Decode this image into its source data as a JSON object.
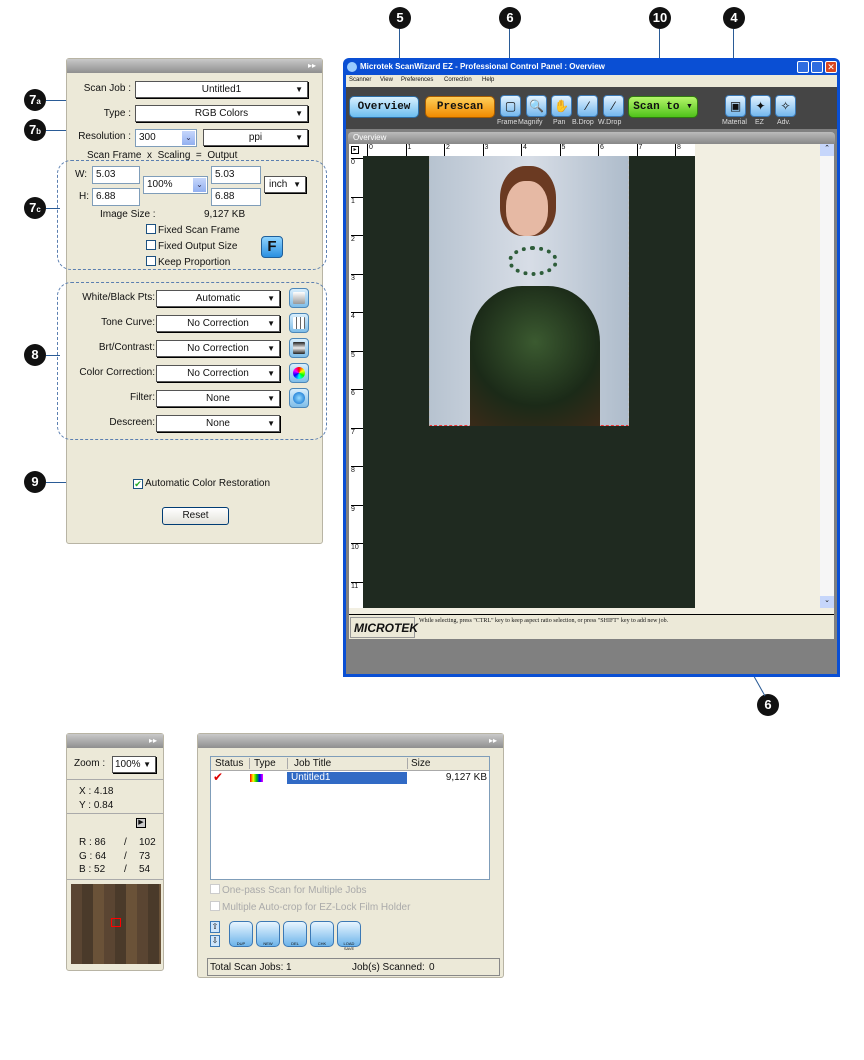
{
  "callouts": {
    "c5": "5",
    "c6a": "6",
    "c10": "10",
    "c4": "4",
    "c7a": "7",
    "c7a_sub": "a",
    "c7b": "7",
    "c7b_sub": "b",
    "c7c": "7",
    "c7c_sub": "c",
    "c8": "8",
    "c9": "9",
    "c6b": "6"
  },
  "settings": {
    "expand": "▸▸",
    "scan_job_label": "Scan Job :",
    "scan_job": "Untitled1",
    "type_label": "Type :",
    "type": "RGB Colors",
    "resolution_label": "Resolution :",
    "resolution": "300",
    "resolution_unit": "ppi",
    "header_row": "Scan Frame  x  Scaling  =  Output",
    "w_label": "W:",
    "h_label": "H:",
    "w_in": "5.03",
    "h_in": "6.88",
    "scaling": "100%",
    "w_out": "5.03",
    "h_out": "6.88",
    "unit": "inch",
    "image_size_label": "Image Size :",
    "image_size": "9,127 KB",
    "fixed_scan_frame": "Fixed Scan Frame",
    "fixed_output_size": "Fixed Output Size",
    "keep_proportion": "Keep Proportion",
    "f_button": "F",
    "corrections": [
      {
        "label": "White/Black Pts:",
        "value": "Automatic"
      },
      {
        "label": "Tone Curve:",
        "value": "No Correction"
      },
      {
        "label": "Brt/Contrast:",
        "value": "No Correction"
      },
      {
        "label": "Color Correction:",
        "value": "No Correction"
      },
      {
        "label": "Filter:",
        "value": "None"
      },
      {
        "label": "Descreen:",
        "value": "None"
      }
    ],
    "acr": "Automatic Color Restoration",
    "acr_checked": true,
    "reset": "Reset"
  },
  "window": {
    "title": "Microtek ScanWizard EZ - Professional Control Panel : Overview",
    "menu": [
      "Scanner",
      "View",
      "Preferences",
      "Correction",
      "Help"
    ],
    "overview": "Overview",
    "prescan": "Prescan",
    "scan_to": "Scan to ▾",
    "tools": [
      "Frame",
      "Magnify",
      "Pan",
      "B.Drop",
      "W.Drop"
    ],
    "modes": [
      "Material",
      "EZ",
      "Adv."
    ],
    "pane_title": "Overview",
    "ruler_x": [
      "0",
      "1",
      "2",
      "3",
      "4",
      "5",
      "6",
      "7",
      "8"
    ],
    "ruler_y": [
      "0",
      "1",
      "2",
      "3",
      "4",
      "5",
      "6",
      "7",
      "8",
      "9",
      "10",
      "11"
    ],
    "logo": "MICROTEK",
    "status": "While selecting, press \"CTRL\" key to keep aspect ratio selection, or press \"SHIFT\" key to add new job."
  },
  "info": {
    "expand": "▸▸",
    "zoom_label": "Zoom :",
    "zoom": "100%",
    "x": "X : 4.18",
    "y": "Y : 0.84",
    "r": "R : 86",
    "r2": "102",
    "g": "G : 64",
    "g2": "73",
    "b": "B : 52",
    "b2": "54",
    "sep": "/"
  },
  "jobs": {
    "expand": "▸▸",
    "columns": [
      "Status",
      "Type",
      "Job Title",
      "Size"
    ],
    "rows": [
      {
        "title": "Untitled1",
        "size": "9,127 KB"
      }
    ],
    "one_pass": "One-pass Scan for Multiple Jobs",
    "auto_crop": "Multiple Auto-crop for EZ-Lock Film Holder",
    "buttons": [
      "DUP",
      "NEW",
      "DEL",
      "CHK",
      "LOAD SAVE"
    ],
    "total_label": "Total Scan Jobs:",
    "total": "1",
    "scanned_label": "Job(s) Scanned:",
    "scanned": "0"
  }
}
